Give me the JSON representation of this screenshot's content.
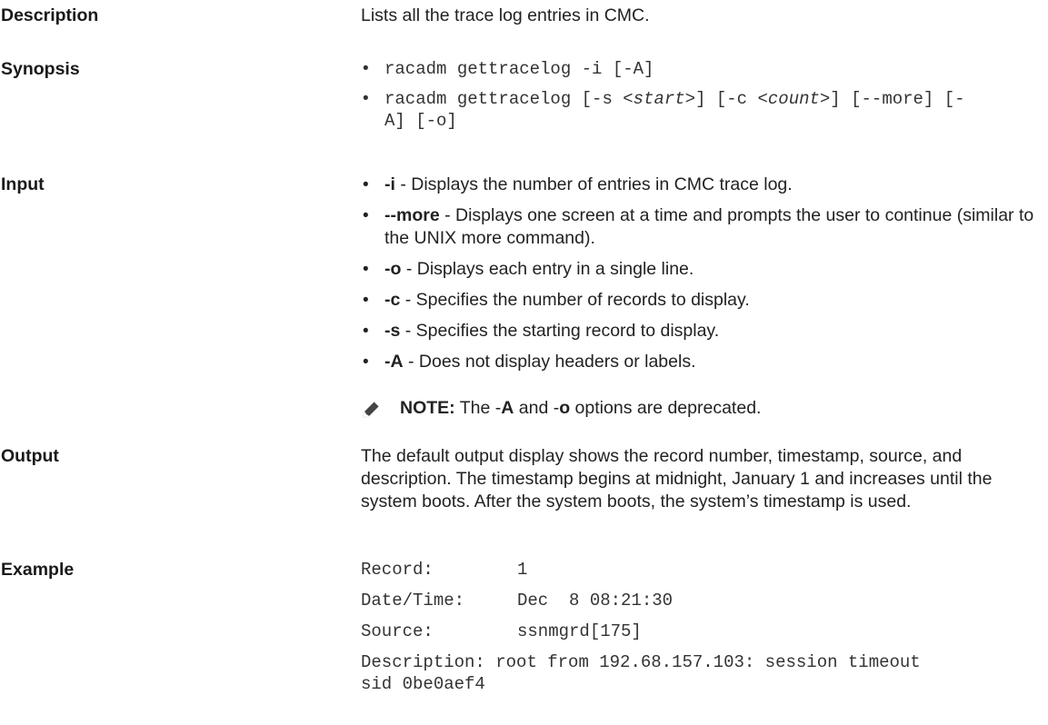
{
  "description": {
    "label": "Description",
    "text": "Lists all the trace log entries in CMC."
  },
  "synopsis": {
    "label": "Synopsis",
    "line1": "racadm gettracelog -i [-A]",
    "line2_a": "racadm gettracelog [-s <",
    "line2_start": "start",
    "line2_b": ">] [-c <",
    "line2_count": "count",
    "line2_c": ">] [--more] [-",
    "line2_d": "A] [-o]"
  },
  "input": {
    "label": "Input",
    "items": [
      {
        "flag": "-i",
        "text": " - Displays the number of entries in CMC trace log."
      },
      {
        "flag": "--more",
        "text": " - Displays one screen at a time and prompts the user to continue (similar to the UNIX more command)."
      },
      {
        "flag": "-o",
        "text": " - Displays each entry in a single line."
      },
      {
        "flag": "-c",
        "text": " - Specifies the number of records to display."
      },
      {
        "flag": "-s",
        "text": " - Specifies the starting record to display."
      },
      {
        "flag": "-A",
        "text": " - Does not display headers or labels."
      }
    ],
    "note": {
      "prefix": "NOTE:",
      "t1": " The -",
      "flag1": "A",
      "t2": " and -",
      "flag2": "o",
      "t3": " options are deprecated."
    }
  },
  "output": {
    "label": "Output",
    "text": "The default output display shows the record number, timestamp, source, and description. The timestamp begins at midnight, January 1 and increases until the system boots. After the system boots, the system’s timestamp is used."
  },
  "example": {
    "label": "Example",
    "rows": [
      {
        "key": "Record:",
        "value": "1"
      },
      {
        "key": "Date/Time:",
        "value": "Dec  8 08:21:30"
      },
      {
        "key": "Source:",
        "value": "ssnmgrd[175]"
      },
      {
        "key": "Description:",
        "value": "root from 192.68.157.103: session timeout"
      }
    ],
    "continuation": "sid 0be0aef4"
  },
  "bullet_glyph": "•",
  "icon": "note-pencil-icon"
}
